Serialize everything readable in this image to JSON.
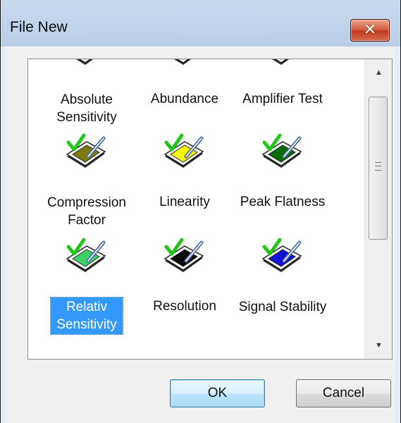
{
  "window": {
    "title": "File New",
    "close_glyph": "✕"
  },
  "list": {
    "items": [
      {
        "label": "Absolute Sensitivity",
        "icon": "absolute-sensitivity-icon",
        "color": "#c8c8c8",
        "selected": false
      },
      {
        "label": "Abundance",
        "icon": "abundance-icon",
        "color": "#7a0f0f",
        "selected": false
      },
      {
        "label": "Amplifier Test",
        "icon": "amplifier-test-icon",
        "color": "#e81414",
        "selected": false
      },
      {
        "label": "Compression Factor",
        "icon": "compression-factor-icon",
        "color": "#7d7a12",
        "selected": false
      },
      {
        "label": "Linearity",
        "icon": "linearity-icon",
        "color": "#f4f40a",
        "selected": false
      },
      {
        "label": "Peak Flatness",
        "icon": "peak-flatness-icon",
        "color": "#0b6a0b",
        "selected": false
      },
      {
        "label": "Relativ Sensitivity",
        "icon": "relativ-sensitivity-icon",
        "color": "#3fd26a",
        "selected": true
      },
      {
        "label": "Resolution",
        "icon": "resolution-icon",
        "color": "#0c0c0c",
        "selected": false
      },
      {
        "label": "Signal Stability",
        "icon": "signal-stability-icon",
        "color": "#1212d8",
        "selected": false
      }
    ]
  },
  "scrollbar": {
    "up_glyph": "▲",
    "down_glyph": "▼"
  },
  "buttons": {
    "ok": "OK",
    "cancel": "Cancel"
  },
  "colors": {
    "selection": "#3399ff",
    "check": "#22c51a",
    "pen": "#4f6fa0"
  }
}
